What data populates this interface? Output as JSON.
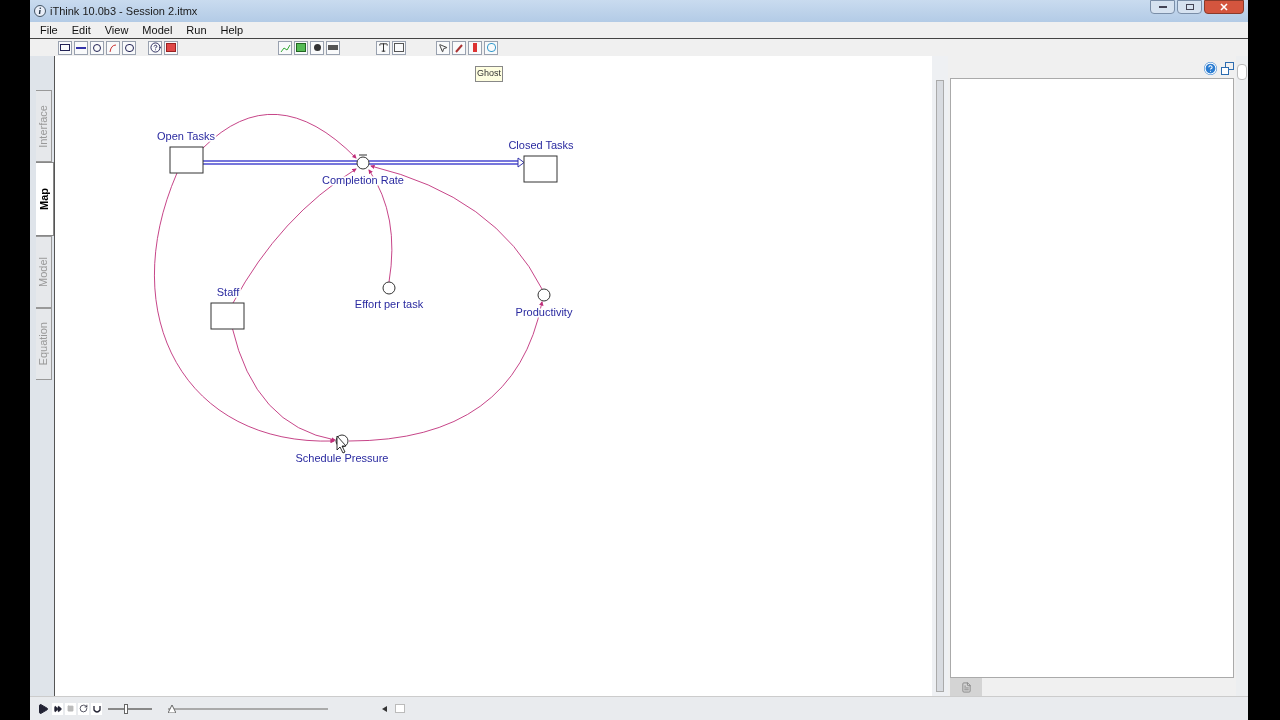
{
  "window": {
    "title": "iThink 10.0b3 - Session 2.itmx"
  },
  "menu": [
    "File",
    "Edit",
    "View",
    "Model",
    "Run",
    "Help"
  ],
  "side_tabs": [
    {
      "label": "Interface",
      "selected": false
    },
    {
      "label": "Map",
      "selected": true
    },
    {
      "label": "Model",
      "selected": false
    },
    {
      "label": "Equation",
      "selected": false
    }
  ],
  "tooltip": "Ghost",
  "diagram": {
    "nodes": [
      {
        "kind": "stock",
        "label": "Open Tasks"
      },
      {
        "kind": "stock",
        "label": "Closed Tasks"
      },
      {
        "kind": "flow",
        "label": "Completion Rate"
      },
      {
        "kind": "stock",
        "label": "Staff"
      },
      {
        "kind": "converter",
        "label": "Effort per task"
      },
      {
        "kind": "converter",
        "label": "Productivity"
      },
      {
        "kind": "converter",
        "label": "Schedule Pressure"
      }
    ]
  },
  "speed_slider": {
    "level": 0.4
  },
  "time_slider": {
    "level": 0
  }
}
